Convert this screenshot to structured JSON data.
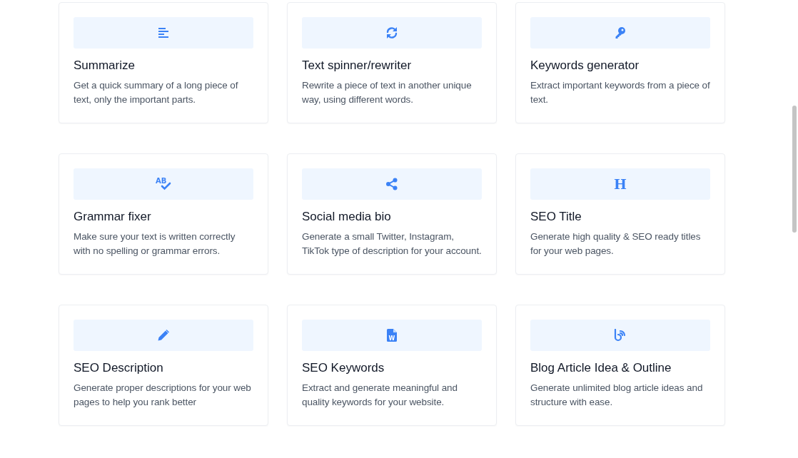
{
  "tools": [
    {
      "kind": "lines",
      "title": "Summarize",
      "description": "Get a quick summary of a long piece of text, only the important parts."
    },
    {
      "kind": "refresh",
      "title": "Text spinner/rewriter",
      "description": "Rewrite a piece of text in another unique way, using different words."
    },
    {
      "kind": "key",
      "title": "Keywords generator",
      "description": "Extract important keywords from a piece of text."
    },
    {
      "kind": "spellcheck",
      "icon_label": "AB",
      "title": "Grammar fixer",
      "description": "Make sure your text is written correctly with no spelling or grammar errors."
    },
    {
      "kind": "share",
      "title": "Social media bio",
      "description": "Generate a small Twitter, Instagram, TikTok type of description for your account."
    },
    {
      "kind": "heading",
      "icon_label": "H",
      "title": "SEO Title",
      "description": "Generate high quality & SEO ready titles for your web pages."
    },
    {
      "kind": "pencil",
      "title": "SEO Description",
      "description": "Generate proper descriptions for your web pages to help you rank better"
    },
    {
      "kind": "document",
      "icon_label": "W",
      "title": "SEO Keywords",
      "description": "Extract and generate meaningful and quality keywords for your website."
    },
    {
      "kind": "blog",
      "title": "Blog Article Idea & Outline",
      "description": "Generate unlimited blog article ideas and structure with ease."
    }
  ]
}
